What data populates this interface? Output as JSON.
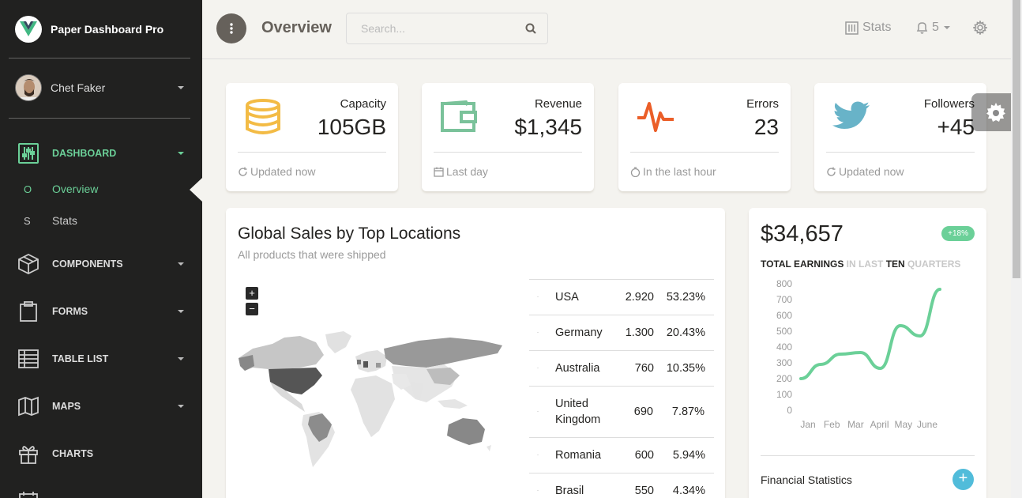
{
  "brand": {
    "name": "Paper Dashboard Pro"
  },
  "user": {
    "name": "Chet Faker"
  },
  "sidebar": {
    "items": [
      {
        "label": "DASHBOARD",
        "icon": "sliders-icon",
        "active": true
      },
      {
        "label": "COMPONENTS",
        "icon": "box-icon"
      },
      {
        "label": "FORMS",
        "icon": "clipboard-icon"
      },
      {
        "label": "TABLE LIST",
        "icon": "table-icon"
      },
      {
        "label": "MAPS",
        "icon": "map-icon"
      },
      {
        "label": "CHARTS",
        "icon": "gift-icon"
      }
    ],
    "subitems": [
      {
        "abbr": "O",
        "label": "Overview",
        "active": true
      },
      {
        "abbr": "S",
        "label": "Stats"
      }
    ]
  },
  "topbar": {
    "title": "Overview",
    "search_placeholder": "Search...",
    "stats_label": "Stats",
    "notifications_count": "5"
  },
  "stats": [
    {
      "label": "Capacity",
      "value": "105GB",
      "footer": "Updated now",
      "icon": "database-icon",
      "color": "#f3bb45"
    },
    {
      "label": "Revenue",
      "value": "$1,345",
      "footer": "Last day",
      "icon": "wallet-icon",
      "color": "#7ac29a"
    },
    {
      "label": "Errors",
      "value": "23",
      "footer": "In the last hour",
      "icon": "pulse-icon",
      "color": "#eb5e28"
    },
    {
      "label": "Followers",
      "value": "+45",
      "footer": "Updated now",
      "icon": "twitter-icon",
      "color": "#68b3c8"
    }
  ],
  "sales": {
    "title": "Global Sales by Top Locations",
    "subtitle": "All products that were shipped",
    "zoom_in": "+",
    "zoom_out": "−",
    "rows": [
      {
        "country": "USA",
        "value": "2.920",
        "percent": "53.23%"
      },
      {
        "country": "Germany",
        "value": "1.300",
        "percent": "20.43%"
      },
      {
        "country": "Australia",
        "value": "760",
        "percent": "10.35%"
      },
      {
        "country": "United Kingdom",
        "value": "690",
        "percent": "7.87%"
      },
      {
        "country": "Romania",
        "value": "600",
        "percent": "5.94%"
      },
      {
        "country": "Brasil",
        "value": "550",
        "percent": "4.34%"
      }
    ]
  },
  "earnings": {
    "amount": "$34,657",
    "badge": "+18%",
    "caption_parts": [
      "TOTAL EARNINGS",
      " IN LAST ",
      "TEN",
      " QUARTERS"
    ],
    "financial_title": "Financial Statistics",
    "add_label": "+"
  },
  "chart_data": {
    "type": "line",
    "categories": [
      "Jan",
      "Feb",
      "Mar",
      "April",
      "May",
      "June"
    ],
    "x": [
      0,
      1,
      2,
      3,
      4,
      5,
      6,
      7,
      8,
      9
    ],
    "values": [
      200,
      290,
      355,
      365,
      265,
      535,
      470,
      765
    ],
    "y_ticks": [
      0,
      100,
      200,
      300,
      400,
      500,
      600,
      700,
      800
    ],
    "ylim": [
      0,
      800
    ],
    "color": "#6bd098",
    "grid": false
  }
}
